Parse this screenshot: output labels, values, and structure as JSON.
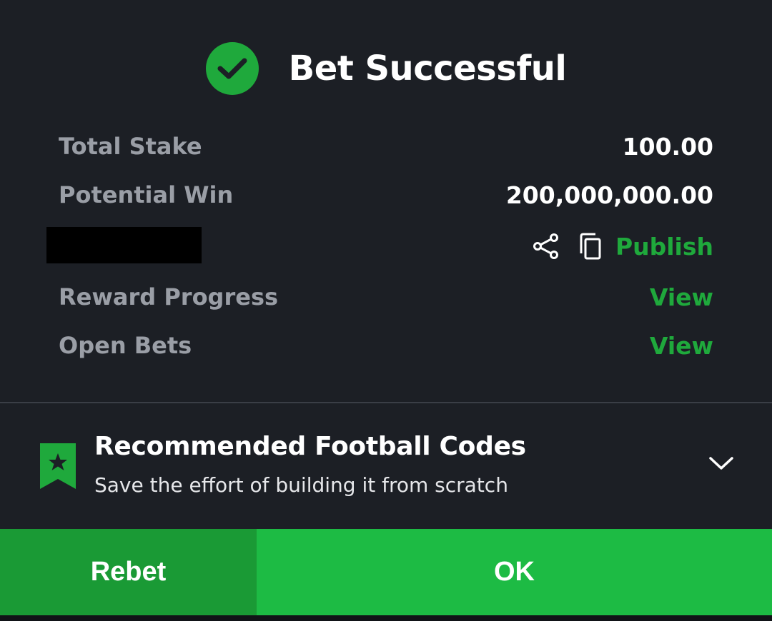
{
  "header": {
    "title": "Bet Successful",
    "icon": "check-circle-icon"
  },
  "summary": {
    "total_stake_label": "Total Stake",
    "total_stake_value": "100.00",
    "potential_win_label": "Potential Win",
    "potential_win_value": "200,000,000.00",
    "publish_label": "Publish",
    "reward_progress_label": "Reward Progress",
    "reward_progress_link": "View",
    "open_bets_label": "Open Bets",
    "open_bets_link": "View"
  },
  "recommended": {
    "title": "Recommended Football Codes",
    "subtitle": "Save the effort of building it from scratch"
  },
  "buttons": {
    "rebet": "Rebet",
    "ok": "OK"
  },
  "colors": {
    "background": "#1c1f25",
    "accent_green": "#1fa93c",
    "ok_green": "#1dbb44",
    "rebet_green": "#1a9a35",
    "muted_text": "#9a9ea6"
  }
}
